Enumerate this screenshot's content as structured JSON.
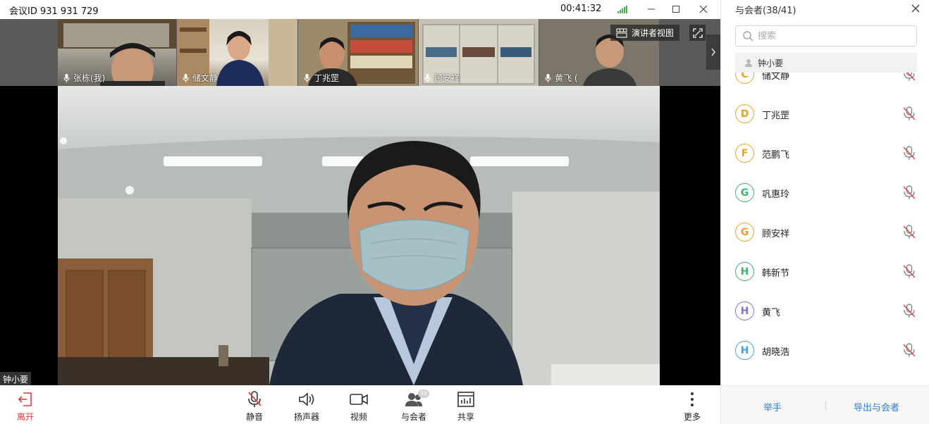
{
  "title_bar": {
    "meeting_id": "会议ID 931 931 729",
    "timer": "00:41:32"
  },
  "thumbnails": [
    {
      "name": "张栋(我)"
    },
    {
      "name": "储文静"
    },
    {
      "name": "丁兆罡"
    },
    {
      "name": "顾安祥"
    },
    {
      "name": "黄飞 ("
    }
  ],
  "presenter_view": {
    "label": "演讲者视图"
  },
  "active_speaker": {
    "name": "钟小要"
  },
  "toolbar": {
    "leave": "离开",
    "mute": "静音",
    "speaker": "扬声器",
    "video": "视频",
    "participants": "与会者",
    "participants_badge": "38",
    "share": "共享",
    "more": "更多"
  },
  "panel": {
    "title": "与会者(38/41)",
    "search_placeholder": "搜索",
    "pinned_name": "钟小要",
    "participants": [
      {
        "letter": "C",
        "name": "储文静",
        "color": "#f0a020"
      },
      {
        "letter": "D",
        "name": "丁兆罡",
        "color": "#f0a020"
      },
      {
        "letter": "F",
        "name": "范鹏飞",
        "color": "#f0a020"
      },
      {
        "letter": "G",
        "name": "巩惠玲",
        "color": "#3cb371"
      },
      {
        "letter": "G",
        "name": "顾安祥",
        "color": "#f0a020"
      },
      {
        "letter": "H",
        "name": "韩新节",
        "color": "#3cb371"
      },
      {
        "letter": "H",
        "name": "黄飞",
        "color": "#8a6fd6"
      },
      {
        "letter": "H",
        "name": "胡晓浩",
        "color": "#4a9fe0"
      }
    ],
    "raise_hand": "举手",
    "export": "导出与会者"
  },
  "colors": {
    "leave_red": "#e23b3b",
    "link_blue": "#2e7fd6",
    "mute_red": "#e04040"
  }
}
